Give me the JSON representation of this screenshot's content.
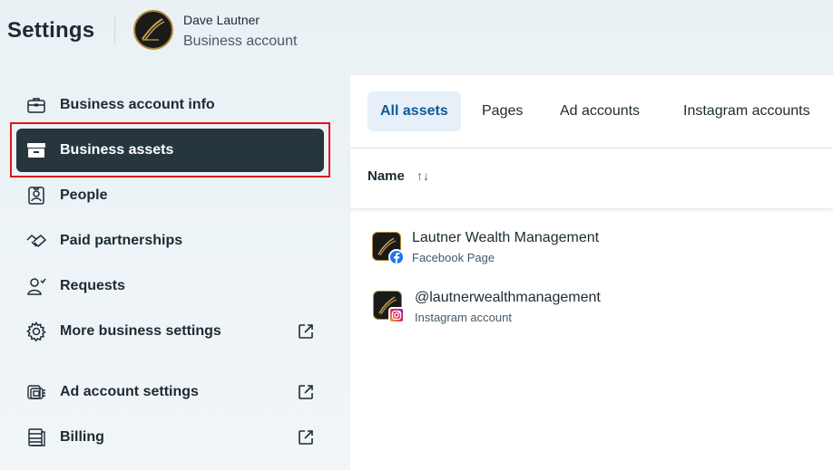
{
  "header": {
    "title": "Settings",
    "user_name": "Dave Lautner",
    "account_type": "Business account"
  },
  "sidebar": {
    "items": [
      {
        "label": "Business account info",
        "icon": "briefcase-icon",
        "external": false
      },
      {
        "label": "Business assets",
        "icon": "archive-box-icon",
        "external": false,
        "active": true
      },
      {
        "label": "People",
        "icon": "id-badge-icon",
        "external": false
      },
      {
        "label": "Paid partnerships",
        "icon": "handshake-icon",
        "external": false
      },
      {
        "label": "Requests",
        "icon": "person-add-icon",
        "external": false
      },
      {
        "label": "More business settings",
        "icon": "gear-icon",
        "external": true
      },
      {
        "label": "Ad account settings",
        "icon": "ad-account-icon",
        "external": true
      },
      {
        "label": "Billing",
        "icon": "billing-icon",
        "external": true
      }
    ]
  },
  "tabs": [
    {
      "label": "All assets",
      "active": true
    },
    {
      "label": "Pages",
      "active": false
    },
    {
      "label": "Ad accounts",
      "active": false
    },
    {
      "label": "Instagram accounts",
      "active": false
    }
  ],
  "table": {
    "column_name": "Name",
    "sort_indicator": "↑↓",
    "rows": [
      {
        "name": "Lautner Wealth Management",
        "type": "Facebook Page",
        "badge": "facebook-icon"
      },
      {
        "name": "@lautnerwealthmanagement",
        "type": "Instagram account",
        "badge": "instagram-icon"
      }
    ]
  },
  "colors": {
    "active_nav_bg": "#27353e",
    "highlight_outline": "#e0151b",
    "active_tab_bg": "#e7f0f8",
    "active_tab_text": "#0a5a9a",
    "facebook_blue": "#1877f2"
  }
}
